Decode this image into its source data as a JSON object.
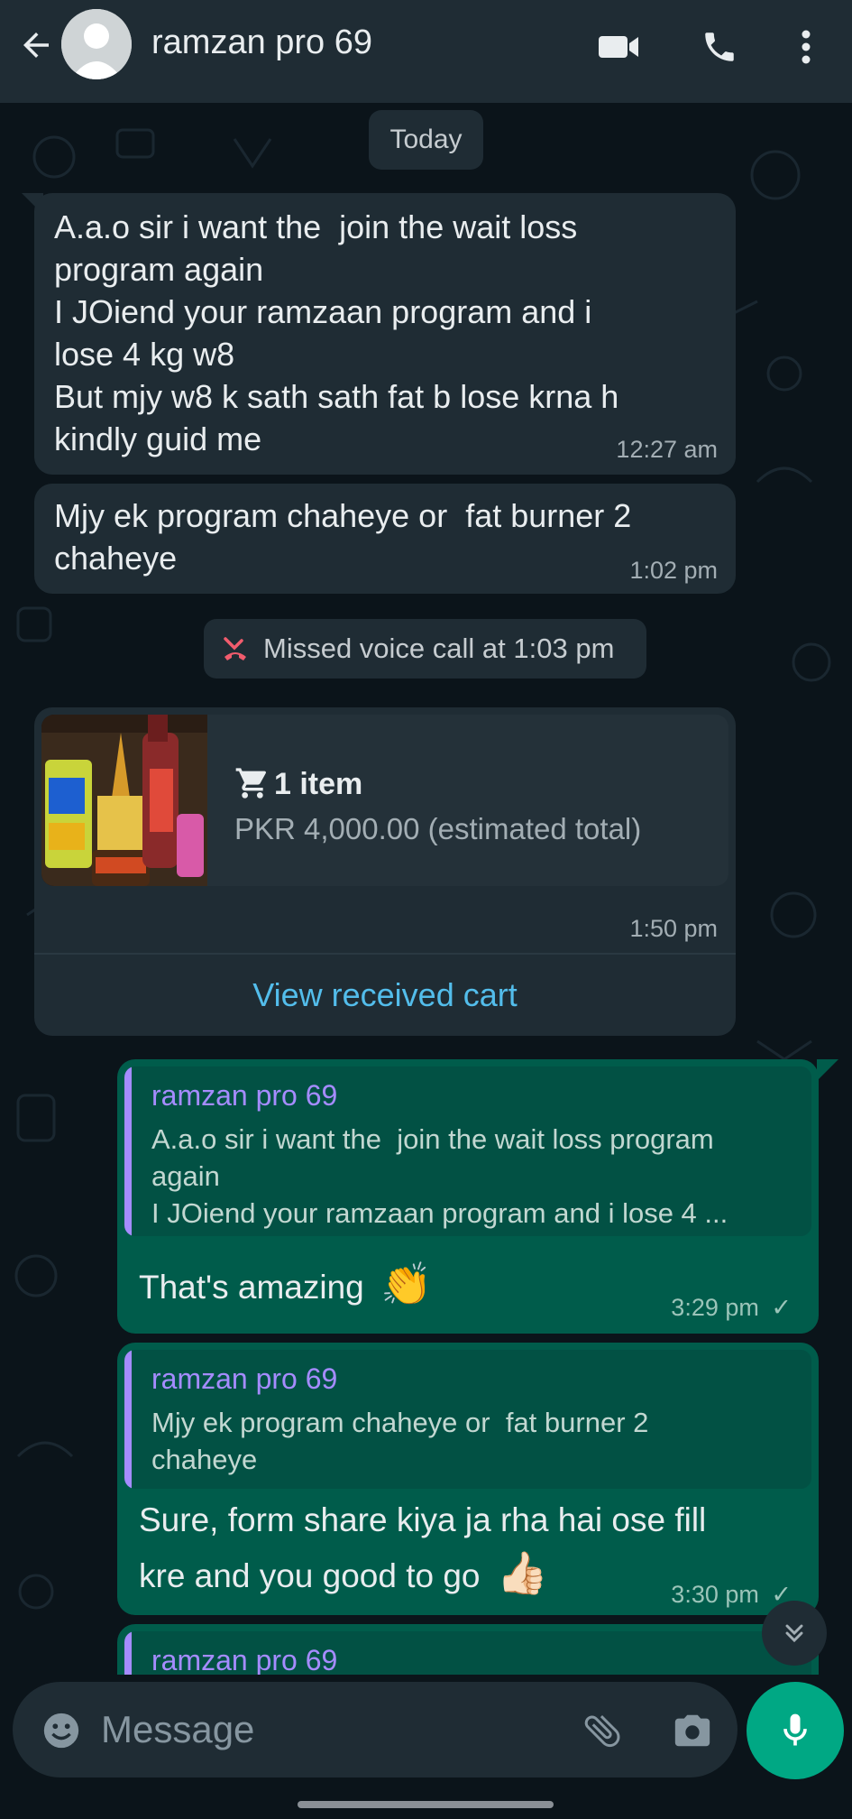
{
  "header": {
    "contact_name": "ramzan pro 69",
    "icons": [
      "back-arrow-icon",
      "avatar",
      "video-call-icon",
      "voice-call-icon",
      "more-options-icon"
    ]
  },
  "date_chip": "Today",
  "messages": {
    "m1": {
      "text": "A.a.o sir i want the  join the wait loss\nprogram again\nI JOiend your ramzaan program and i\nlose 4 kg w8\nBut mjy w8 k sath sath fat b lose krna h\nkindly guid me",
      "time": "12:27 am"
    },
    "m2": {
      "text": "Mjy ek program chaheye or  fat burner 2\nchaheye",
      "time": "1:02 pm"
    },
    "missed_call": "Missed voice call at 1:03 pm",
    "cart": {
      "items": "1 item",
      "total": "PKR 4,000.00 (estimated total)",
      "time": "1:50 pm",
      "link": "View received cart"
    },
    "out1": {
      "quote_name": "ramzan pro 69",
      "quote_text": "A.a.o sir i want the  join the wait loss program\nagain\nI JOiend your ramzaan program and i lose 4 ...",
      "text": "That's amazing",
      "emoji": "👏",
      "time": "3:29 pm"
    },
    "out2": {
      "quote_name": "ramzan pro 69",
      "quote_text": "Mjy ek program chaheye or  fat burner 2\nchaheye",
      "text_line1": "Sure, form share kiya ja rha hai ose fill",
      "text_line2": "kre and you good to go",
      "emoji": "👍🏻",
      "time": "3:30 pm"
    },
    "out3": {
      "quote_name": "ramzan pro 69"
    }
  },
  "composer": {
    "placeholder": "Message"
  },
  "colors": {
    "background": "#0b141a",
    "header": "#1f2c34",
    "incoming_bubble": "#1f2c34",
    "outgoing_bubble": "#005c4b",
    "accent_green": "#00a884",
    "link_blue": "#53bdeb",
    "quote_purple": "#a58cff"
  }
}
